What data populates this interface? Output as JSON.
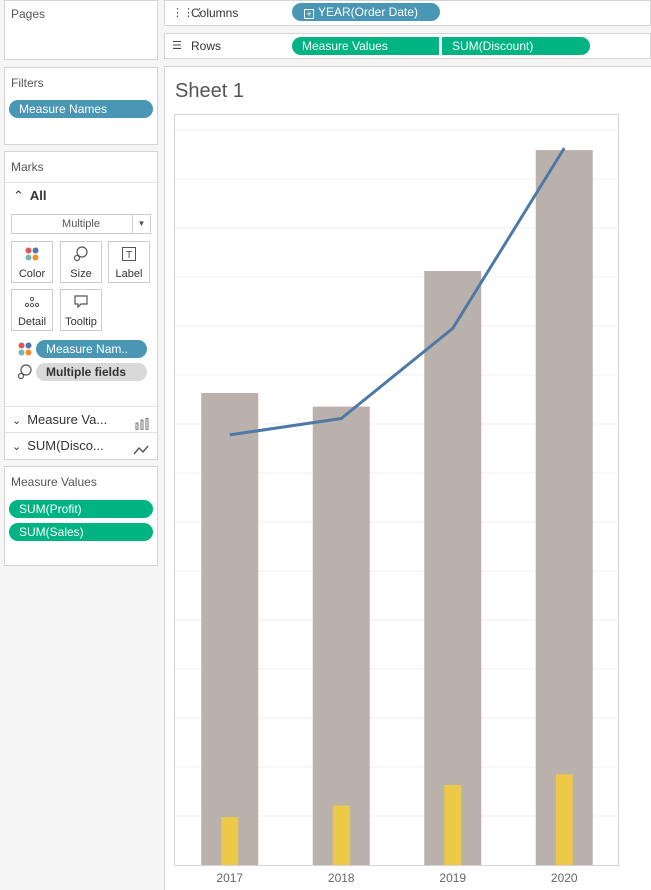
{
  "pages": {
    "title": "Pages"
  },
  "columns": {
    "label": "Columns",
    "pill": "YEAR(Order Date)"
  },
  "rows": {
    "label": "Rows",
    "pills": [
      "Measure Values",
      "SUM(Discount)"
    ]
  },
  "filters": {
    "title": "Filters",
    "pill": "Measure Names"
  },
  "marks": {
    "title": "Marks",
    "all_label": "All",
    "mark_type": "Multiple",
    "buttons": {
      "color": "Color",
      "size": "Size",
      "label": "Label",
      "detail": "Detail",
      "tooltip": "Tooltip"
    },
    "color_pill": "Measure Nam..",
    "size_pill": "Multiple fields",
    "sections": [
      "Measure Va...",
      "SUM(Disco..."
    ]
  },
  "measure_values": {
    "title": "Measure Values",
    "items": [
      "SUM(Profit)",
      "SUM(Sales)"
    ]
  },
  "sheet": {
    "title": "Sheet 1"
  },
  "colors": {
    "sales_bar": "#bab0ac",
    "profit_bar": "#edc948",
    "discount_line": "#4e79a7",
    "blue_pill": "#4a96b5",
    "green_pill": "#00b383"
  },
  "chart_data": {
    "type": "bar",
    "categories": [
      "2017",
      "2018",
      "2019",
      "2020"
    ],
    "series": [
      {
        "name": "SUM(Sales)",
        "type": "bar",
        "values": [
          484000,
          470000,
          609000,
          733000
        ]
      },
      {
        "name": "SUM(Profit)",
        "type": "bar",
        "values": [
          49000,
          61000,
          82000,
          93000
        ]
      },
      {
        "name": "SUM(Discount)",
        "type": "line",
        "values": [
          315,
          327,
          393,
          525
        ]
      }
    ],
    "ylim": [
      0,
      770000
    ],
    "y2lim": [
      0,
      550
    ],
    "grid": true
  }
}
